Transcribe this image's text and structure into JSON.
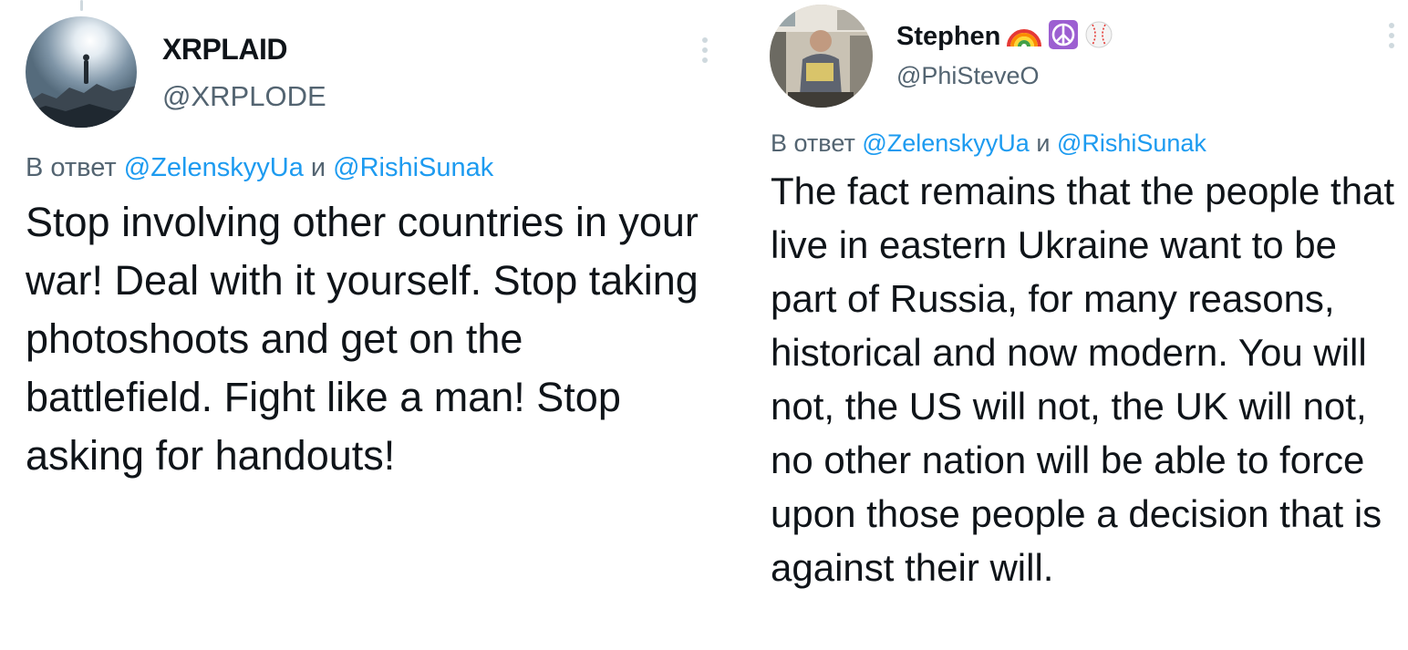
{
  "left_tweet": {
    "display_name": "XRPLAID",
    "handle": "@XRPLODE",
    "reply_prefix": "В ответ",
    "reply_mention_1": "@ZelenskyyUa",
    "reply_conjunction": "и",
    "reply_mention_2": "@RishiSunak",
    "text": "Stop involving other countries in your war! Deal with it yourself. Stop taking photoshoots and get on the battlefield. Fight like a man! Stop asking for handouts!",
    "avatar_icon": "mountain-silhouette-avatar",
    "more_icon": "more-vertical-icon"
  },
  "right_tweet": {
    "display_name": "Stephen",
    "name_emojis": [
      "rainbow-emoji",
      "peace-symbol-emoji",
      "baseball-emoji"
    ],
    "handle": "@PhiSteveO",
    "reply_prefix": "В ответ",
    "reply_mention_1": "@ZelenskyyUa",
    "reply_conjunction": "и",
    "reply_mention_2": "@RishiSunak",
    "text": "The fact remains that the people that live in eastern Ukraine want to be part of Russia, for many reasons, historical and now modern. You will not, the US will not, the UK will not, no other nation will be able to force upon those people a decision that is against their will.",
    "avatar_icon": "person-photo-avatar",
    "more_icon": "more-vertical-icon"
  },
  "colors": {
    "text": "#0f1419",
    "secondary": "#536471",
    "link": "#1d9bf0",
    "divider": "#cfd9de"
  }
}
